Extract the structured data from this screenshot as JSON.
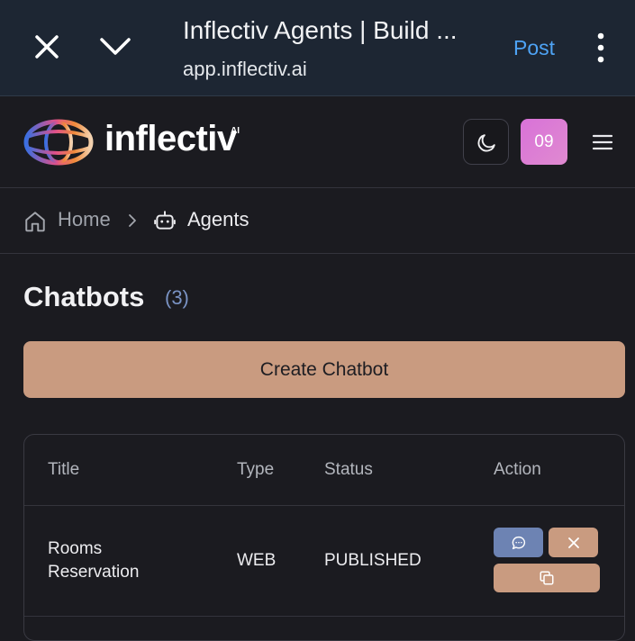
{
  "browser": {
    "title": "Inflectiv Agents | Build ...",
    "url": "app.inflectiv.ai",
    "post_label": "Post"
  },
  "header": {
    "logo_text": "inflectiv",
    "logo_suffix": "AI",
    "avatar_text": "09"
  },
  "breadcrumb": {
    "home": "Home",
    "current": "Agents"
  },
  "main": {
    "heading": "Chatbots",
    "count": "(3)",
    "create_button": "Create Chatbot"
  },
  "table": {
    "columns": [
      "Title",
      "Type",
      "Status",
      "Action"
    ],
    "rows": [
      {
        "title": "Rooms Reservation",
        "type": "WEB",
        "status": "PUBLISHED"
      }
    ]
  },
  "colors": {
    "accent": "#c99b80",
    "chat_action": "#6d83b3",
    "link": "#4ea3f5",
    "avatar": "#d872d8"
  }
}
